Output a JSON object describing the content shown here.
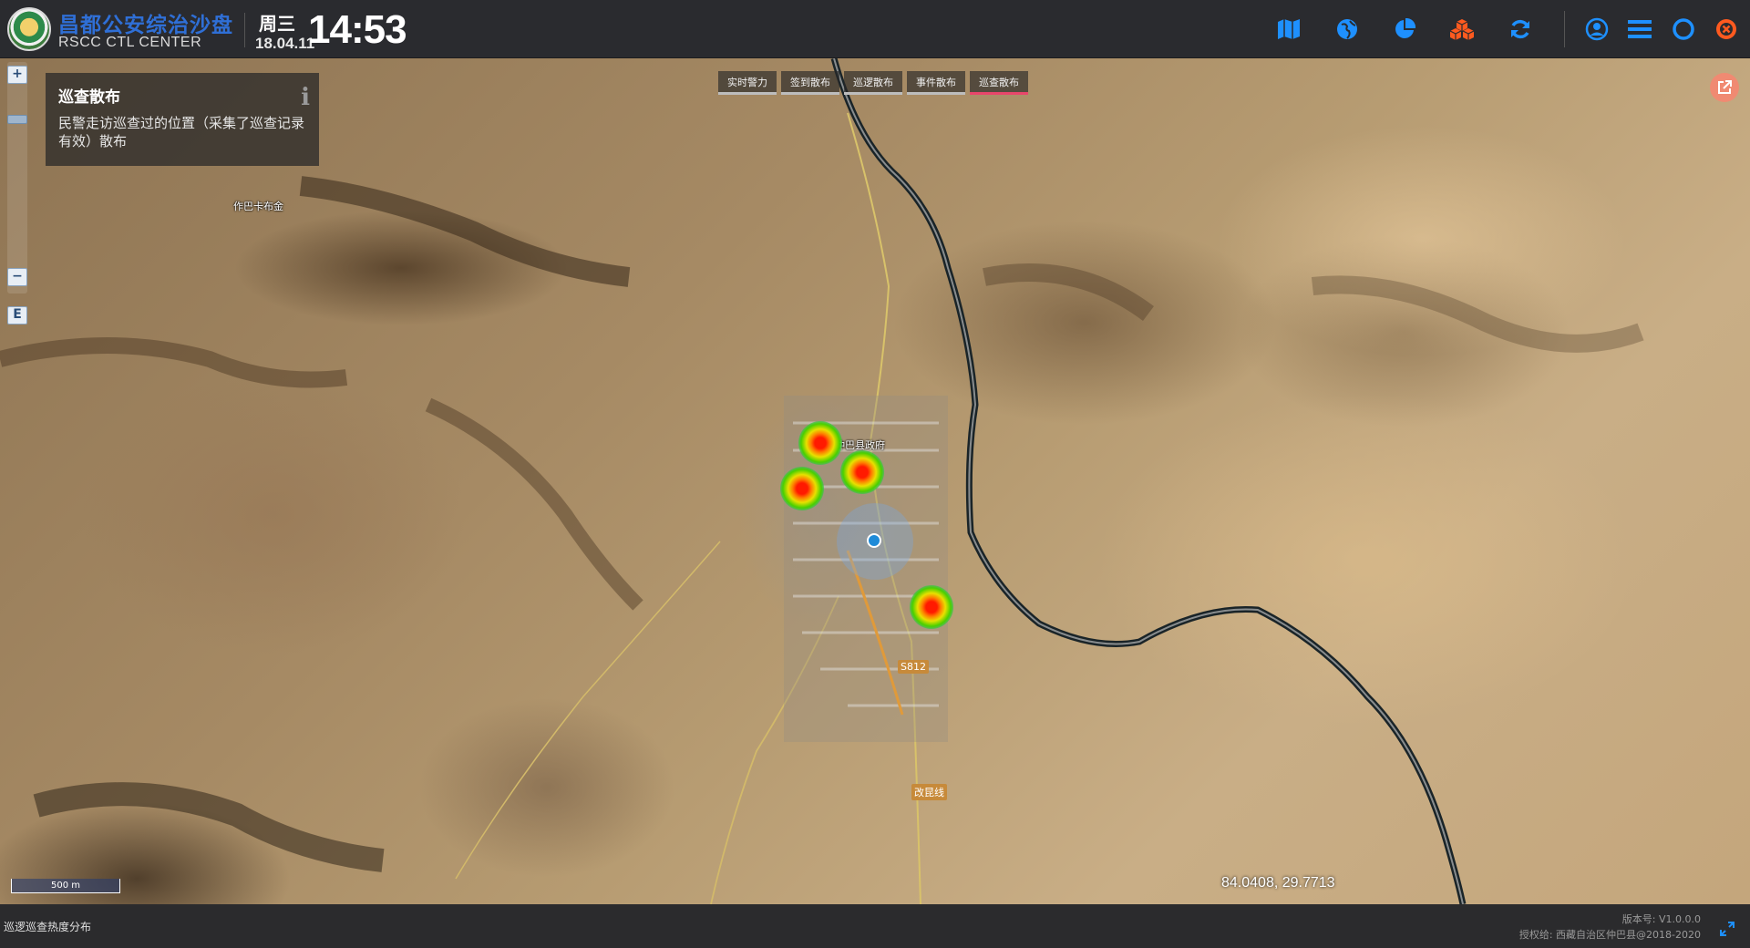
{
  "header": {
    "brand_title": "昌都公安综治沙盘",
    "brand_subtitle": "RSCC CTL CENTER",
    "weekday": "周三",
    "date": "18.04.11",
    "time": "14:53",
    "toolbar_icons": [
      "map-icon",
      "globe-icon",
      "pie-chart-icon",
      "cubes-icon",
      "refresh-icon",
      "user-icon",
      "menu-icon",
      "circle-icon",
      "close-icon"
    ],
    "accent_color": "#1e90ff",
    "orange_color": "#ff5a1f"
  },
  "info_panel": {
    "title": "巡查散布",
    "description": "民警走访巡查过的位置（采集了巡查记录有效）散布"
  },
  "zoom": {
    "in_label": "+",
    "out_label": "−",
    "extra_label": "E"
  },
  "tabs": [
    {
      "label": "实时警力",
      "active": false
    },
    {
      "label": "签到散布",
      "active": false
    },
    {
      "label": "巡逻散布",
      "active": false
    },
    {
      "label": "事件散布",
      "active": false
    },
    {
      "label": "巡查散布",
      "active": true
    }
  ],
  "map": {
    "place_labels": [
      "作巴卡布金",
      "仲巴县政府"
    ],
    "road_labels": [
      "S812",
      "改昆线"
    ],
    "scale_label": "500 m",
    "coordinates": "84.0408, 29.7713"
  },
  "footer": {
    "status_text": "巡逻巡查热度分布",
    "version": "版本号: V1.0.0.0",
    "license": "授权给: 西藏自治区仲巴县@2018-2020"
  }
}
